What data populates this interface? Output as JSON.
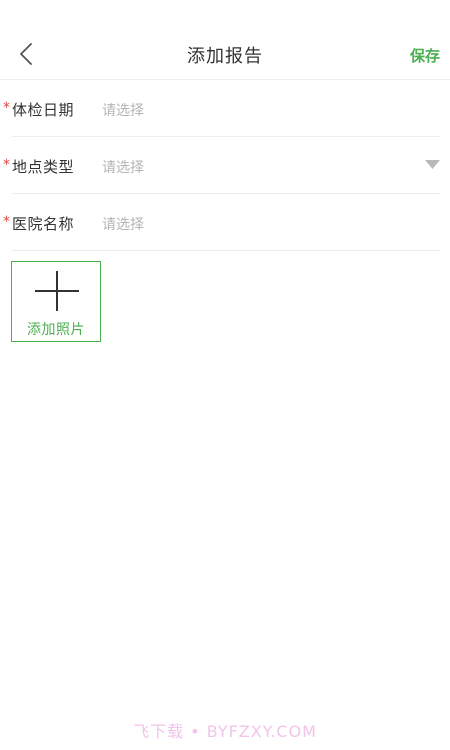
{
  "header": {
    "title": "添加报告",
    "save_label": "保存",
    "back_icon": "chevron-left-icon"
  },
  "form": {
    "required_mark": "*",
    "rows": [
      {
        "label": "体检日期",
        "placeholder": "请选择",
        "has_dropdown": false
      },
      {
        "label": "地点类型",
        "placeholder": "请选择",
        "has_dropdown": true
      },
      {
        "label": "医院名称",
        "placeholder": "请选择",
        "has_dropdown": false
      }
    ]
  },
  "photo": {
    "label": "添加照片",
    "icon": "plus-icon"
  },
  "watermark": "飞下载 • BYFZXY.COM",
  "colors": {
    "accent": "#4caf50",
    "required": "#e0473f",
    "placeholder": "#b4b4b4",
    "divider": "#ececec",
    "watermark": "#f2c4ea"
  }
}
